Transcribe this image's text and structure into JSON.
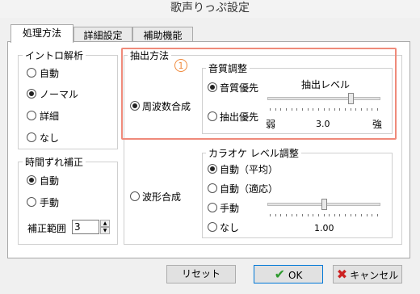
{
  "window": {
    "title": "歌声りっぷ設定"
  },
  "tabs": [
    {
      "label": "処理方法"
    },
    {
      "label": "詳細設定"
    },
    {
      "label": "補助機能"
    }
  ],
  "intro_group": {
    "title": "イントロ解析",
    "options": [
      {
        "label": "自動",
        "checked": false
      },
      {
        "label": "ノーマル",
        "checked": true
      },
      {
        "label": "詳細",
        "checked": false
      },
      {
        "label": "なし",
        "checked": false
      }
    ]
  },
  "timing_group": {
    "title": "時間ずれ補正",
    "options": [
      {
        "label": "自動",
        "checked": true
      },
      {
        "label": "手動",
        "checked": false
      }
    ],
    "range_label": "補正範囲",
    "range_value": "3"
  },
  "extraction": {
    "title": "抽出方法",
    "marker": "1",
    "frequency_label": "周波数合成",
    "frequency_checked": true,
    "waveform_label": "波形合成",
    "waveform_checked": false
  },
  "tone_group": {
    "title": "音質調整",
    "options": [
      {
        "label": "音質優先",
        "checked": true
      },
      {
        "label": "抽出優先",
        "checked": false
      }
    ],
    "slider_title": "抽出レベル",
    "slider_min_label": "弱",
    "slider_max_label": "強",
    "slider_value": "3.0",
    "slider_level": 0.75
  },
  "karaoke_group": {
    "title": "カラオケ レベル調整",
    "options": [
      {
        "label": "自動（平均）",
        "checked": true
      },
      {
        "label": "自動（適応）",
        "checked": false
      },
      {
        "label": "手動",
        "checked": false
      },
      {
        "label": "なし",
        "checked": false
      }
    ],
    "slider_value": "1.00",
    "slider_level": 0.5
  },
  "buttons": {
    "reset": "リセット",
    "ok": "OK",
    "cancel": "キャンセル"
  },
  "colors": {
    "accent": "#0078d7",
    "highlight_box": "#ef8a7a",
    "marker": "#f08a3c"
  }
}
